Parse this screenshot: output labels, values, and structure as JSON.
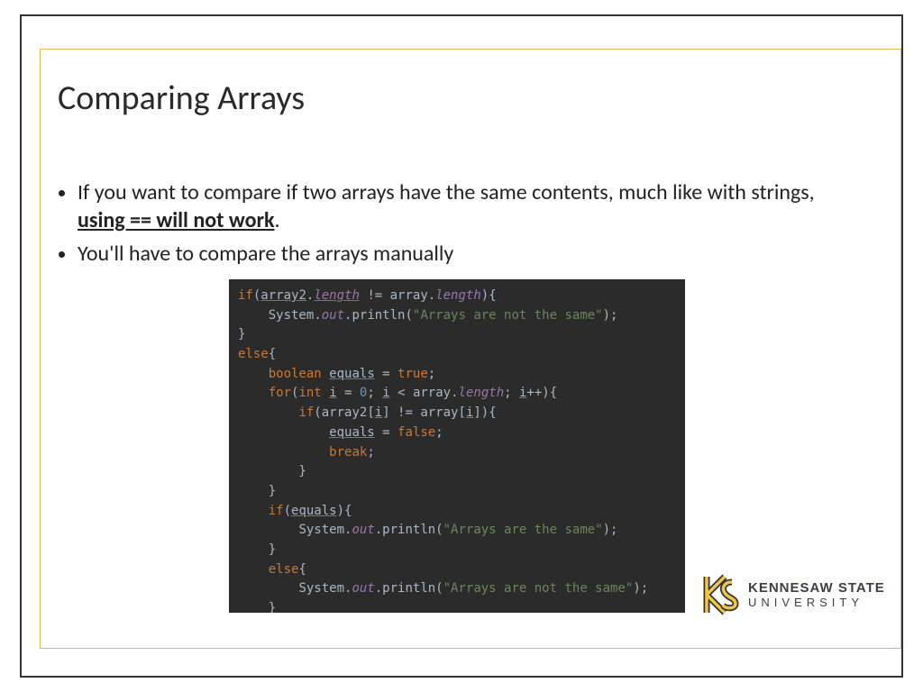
{
  "title": "Comparing Arrays",
  "bullets": {
    "b1_pre": "If you want to compare if two arrays have the same contents, much like with strings, ",
    "b1_emph": "using == will not work",
    "b1_post": ".",
    "b2": "You'll have to compare the arrays manually"
  },
  "code_tokens": [
    [
      [
        "kw",
        "if"
      ],
      [
        "pn",
        "("
      ],
      [
        "ul id",
        "array2"
      ],
      [
        "pn",
        "."
      ],
      [
        "ul prop",
        "length"
      ],
      [
        "pn",
        " != "
      ],
      [
        "id",
        "array"
      ],
      [
        "pn",
        "."
      ],
      [
        "prop",
        "length"
      ],
      [
        "pn",
        "){"
      ]
    ],
    [
      [
        "pn",
        "    "
      ],
      [
        "id",
        "System"
      ],
      [
        "pn",
        "."
      ],
      [
        "static",
        "out"
      ],
      [
        "pn",
        ".println("
      ],
      [
        "str",
        "\"Arrays are not the same\""
      ],
      [
        "pn",
        ");"
      ]
    ],
    [
      [
        "pn",
        "}"
      ]
    ],
    [
      [
        "kw",
        "else"
      ],
      [
        "pn",
        "{"
      ]
    ],
    [
      [
        "pn",
        "    "
      ],
      [
        "kw",
        "boolean"
      ],
      [
        "pn",
        " "
      ],
      [
        "ul id",
        "equals"
      ],
      [
        "pn",
        " = "
      ],
      [
        "kw",
        "true"
      ],
      [
        "pn",
        ";"
      ]
    ],
    [
      [
        "pn",
        "    "
      ],
      [
        "kw",
        "for"
      ],
      [
        "pn",
        "("
      ],
      [
        "kw",
        "int"
      ],
      [
        "pn",
        " "
      ],
      [
        "ul id",
        "i"
      ],
      [
        "pn",
        " = "
      ],
      [
        "num",
        "0"
      ],
      [
        "pn",
        "; "
      ],
      [
        "ul id",
        "i"
      ],
      [
        "pn",
        " < "
      ],
      [
        "id",
        "array"
      ],
      [
        "pn",
        "."
      ],
      [
        "prop",
        "length"
      ],
      [
        "pn",
        "; "
      ],
      [
        "ul id",
        "i"
      ],
      [
        "pn",
        "++){"
      ]
    ],
    [
      [
        "pn",
        "        "
      ],
      [
        "kw",
        "if"
      ],
      [
        "pn",
        "("
      ],
      [
        "id",
        "array2"
      ],
      [
        "pn",
        "["
      ],
      [
        "ul id",
        "i"
      ],
      [
        "pn",
        "] != "
      ],
      [
        "id",
        "array"
      ],
      [
        "pn",
        "["
      ],
      [
        "ul id",
        "i"
      ],
      [
        "pn",
        "]){"
      ]
    ],
    [
      [
        "pn",
        "            "
      ],
      [
        "ul id",
        "equals"
      ],
      [
        "pn",
        " = "
      ],
      [
        "kw",
        "false"
      ],
      [
        "pn",
        ";"
      ]
    ],
    [
      [
        "pn",
        "            "
      ],
      [
        "kw",
        "break"
      ],
      [
        "pn",
        ";"
      ]
    ],
    [
      [
        "pn",
        "        }"
      ]
    ],
    [
      [
        "pn",
        "    }"
      ]
    ],
    [
      [
        "pn",
        "    "
      ],
      [
        "kw",
        "if"
      ],
      [
        "pn",
        "("
      ],
      [
        "ul id",
        "equals"
      ],
      [
        "pn",
        "){"
      ]
    ],
    [
      [
        "pn",
        "        "
      ],
      [
        "id",
        "System"
      ],
      [
        "pn",
        "."
      ],
      [
        "static",
        "out"
      ],
      [
        "pn",
        ".println("
      ],
      [
        "str",
        "\"Arrays are the same\""
      ],
      [
        "pn",
        ");"
      ]
    ],
    [
      [
        "pn",
        "    }"
      ]
    ],
    [
      [
        "pn",
        "    "
      ],
      [
        "kw",
        "else"
      ],
      [
        "pn",
        "{"
      ]
    ],
    [
      [
        "pn",
        "        "
      ],
      [
        "id",
        "System"
      ],
      [
        "pn",
        "."
      ],
      [
        "static",
        "out"
      ],
      [
        "pn",
        ".println("
      ],
      [
        "str",
        "\"Arrays are not the same\""
      ],
      [
        "pn",
        ");"
      ]
    ],
    [
      [
        "pn",
        "    }"
      ]
    ],
    [
      [
        "pn",
        "}"
      ]
    ]
  ],
  "logo": {
    "line1": "KENNESAW STATE",
    "line2": "UNIVERSITY"
  }
}
